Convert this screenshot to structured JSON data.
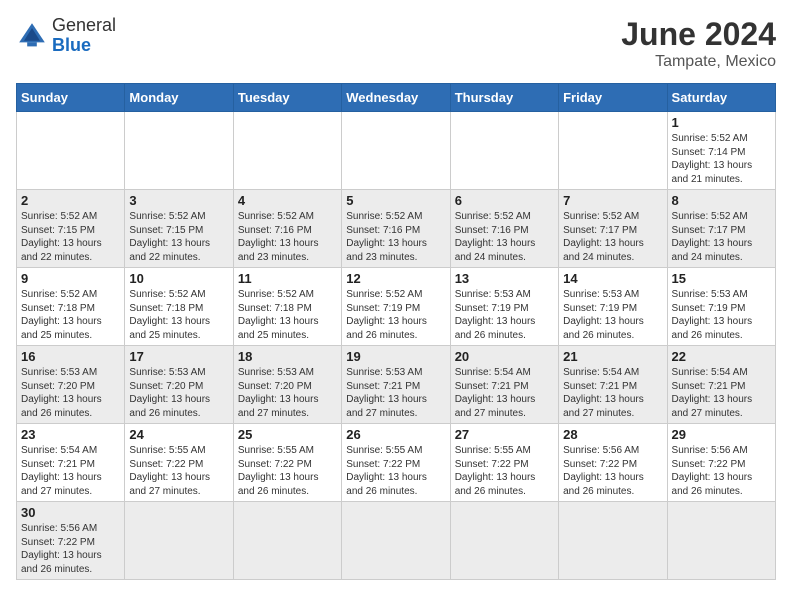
{
  "header": {
    "logo_general": "General",
    "logo_blue": "Blue",
    "month_year": "June 2024",
    "location": "Tampate, Mexico"
  },
  "weekdays": [
    "Sunday",
    "Monday",
    "Tuesday",
    "Wednesday",
    "Thursday",
    "Friday",
    "Saturday"
  ],
  "weeks": [
    [
      {
        "day": "",
        "info": ""
      },
      {
        "day": "",
        "info": ""
      },
      {
        "day": "",
        "info": ""
      },
      {
        "day": "",
        "info": ""
      },
      {
        "day": "",
        "info": ""
      },
      {
        "day": "",
        "info": ""
      },
      {
        "day": "1",
        "info": "Sunrise: 5:52 AM\nSunset: 7:14 PM\nDaylight: 13 hours and 21 minutes."
      }
    ],
    [
      {
        "day": "2",
        "info": "Sunrise: 5:52 AM\nSunset: 7:15 PM\nDaylight: 13 hours and 22 minutes."
      },
      {
        "day": "3",
        "info": "Sunrise: 5:52 AM\nSunset: 7:15 PM\nDaylight: 13 hours and 22 minutes."
      },
      {
        "day": "4",
        "info": "Sunrise: 5:52 AM\nSunset: 7:16 PM\nDaylight: 13 hours and 23 minutes."
      },
      {
        "day": "5",
        "info": "Sunrise: 5:52 AM\nSunset: 7:16 PM\nDaylight: 13 hours and 23 minutes."
      },
      {
        "day": "6",
        "info": "Sunrise: 5:52 AM\nSunset: 7:16 PM\nDaylight: 13 hours and 24 minutes."
      },
      {
        "day": "7",
        "info": "Sunrise: 5:52 AM\nSunset: 7:17 PM\nDaylight: 13 hours and 24 minutes."
      },
      {
        "day": "8",
        "info": "Sunrise: 5:52 AM\nSunset: 7:17 PM\nDaylight: 13 hours and 24 minutes."
      }
    ],
    [
      {
        "day": "9",
        "info": "Sunrise: 5:52 AM\nSunset: 7:18 PM\nDaylight: 13 hours and 25 minutes."
      },
      {
        "day": "10",
        "info": "Sunrise: 5:52 AM\nSunset: 7:18 PM\nDaylight: 13 hours and 25 minutes."
      },
      {
        "day": "11",
        "info": "Sunrise: 5:52 AM\nSunset: 7:18 PM\nDaylight: 13 hours and 25 minutes."
      },
      {
        "day": "12",
        "info": "Sunrise: 5:52 AM\nSunset: 7:19 PM\nDaylight: 13 hours and 26 minutes."
      },
      {
        "day": "13",
        "info": "Sunrise: 5:53 AM\nSunset: 7:19 PM\nDaylight: 13 hours and 26 minutes."
      },
      {
        "day": "14",
        "info": "Sunrise: 5:53 AM\nSunset: 7:19 PM\nDaylight: 13 hours and 26 minutes."
      },
      {
        "day": "15",
        "info": "Sunrise: 5:53 AM\nSunset: 7:19 PM\nDaylight: 13 hours and 26 minutes."
      }
    ],
    [
      {
        "day": "16",
        "info": "Sunrise: 5:53 AM\nSunset: 7:20 PM\nDaylight: 13 hours and 26 minutes."
      },
      {
        "day": "17",
        "info": "Sunrise: 5:53 AM\nSunset: 7:20 PM\nDaylight: 13 hours and 26 minutes."
      },
      {
        "day": "18",
        "info": "Sunrise: 5:53 AM\nSunset: 7:20 PM\nDaylight: 13 hours and 27 minutes."
      },
      {
        "day": "19",
        "info": "Sunrise: 5:53 AM\nSunset: 7:21 PM\nDaylight: 13 hours and 27 minutes."
      },
      {
        "day": "20",
        "info": "Sunrise: 5:54 AM\nSunset: 7:21 PM\nDaylight: 13 hours and 27 minutes."
      },
      {
        "day": "21",
        "info": "Sunrise: 5:54 AM\nSunset: 7:21 PM\nDaylight: 13 hours and 27 minutes."
      },
      {
        "day": "22",
        "info": "Sunrise: 5:54 AM\nSunset: 7:21 PM\nDaylight: 13 hours and 27 minutes."
      }
    ],
    [
      {
        "day": "23",
        "info": "Sunrise: 5:54 AM\nSunset: 7:21 PM\nDaylight: 13 hours and 27 minutes."
      },
      {
        "day": "24",
        "info": "Sunrise: 5:55 AM\nSunset: 7:22 PM\nDaylight: 13 hours and 27 minutes."
      },
      {
        "day": "25",
        "info": "Sunrise: 5:55 AM\nSunset: 7:22 PM\nDaylight: 13 hours and 26 minutes."
      },
      {
        "day": "26",
        "info": "Sunrise: 5:55 AM\nSunset: 7:22 PM\nDaylight: 13 hours and 26 minutes."
      },
      {
        "day": "27",
        "info": "Sunrise: 5:55 AM\nSunset: 7:22 PM\nDaylight: 13 hours and 26 minutes."
      },
      {
        "day": "28",
        "info": "Sunrise: 5:56 AM\nSunset: 7:22 PM\nDaylight: 13 hours and 26 minutes."
      },
      {
        "day": "29",
        "info": "Sunrise: 5:56 AM\nSunset: 7:22 PM\nDaylight: 13 hours and 26 minutes."
      }
    ],
    [
      {
        "day": "30",
        "info": "Sunrise: 5:56 AM\nSunset: 7:22 PM\nDaylight: 13 hours and 26 minutes."
      },
      {
        "day": "",
        "info": ""
      },
      {
        "day": "",
        "info": ""
      },
      {
        "day": "",
        "info": ""
      },
      {
        "day": "",
        "info": ""
      },
      {
        "day": "",
        "info": ""
      },
      {
        "day": "",
        "info": ""
      }
    ]
  ]
}
